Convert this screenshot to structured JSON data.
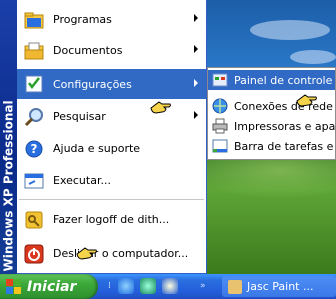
{
  "desktop": {
    "background": "bliss"
  },
  "start_menu": {
    "side_banner": "Windows XP Professional",
    "items": [
      {
        "label": "Programas",
        "icon": "programs-folder-icon",
        "submenu": true
      },
      {
        "label": "Documentos",
        "icon": "documents-folder-icon",
        "submenu": true
      },
      {
        "label": "Configurações",
        "icon": "settings-checklist-icon",
        "submenu": true,
        "active": true
      },
      {
        "label": "Pesquisar",
        "icon": "magnifier-icon",
        "submenu": true
      },
      {
        "label": "Ajuda e suporte",
        "icon": "help-icon",
        "submenu": false
      },
      {
        "label": "Executar...",
        "icon": "run-icon",
        "submenu": false
      },
      {
        "label": "Fazer logoff de dith...",
        "icon": "logoff-key-icon",
        "submenu": false
      },
      {
        "label": "Desligar o computador...",
        "icon": "power-icon",
        "submenu": false
      }
    ]
  },
  "settings_submenu": {
    "items": [
      {
        "label": "Painel de controle",
        "icon": "control-panel-icon",
        "active": true
      },
      {
        "label": "Conexões de rede",
        "icon": "network-connections-icon"
      },
      {
        "label": "Impressoras e aparelhos de fax",
        "icon": "printer-icon"
      },
      {
        "label": "Barra de tarefas e menu Iniciar",
        "icon": "taskbar-icon"
      }
    ]
  },
  "taskbar": {
    "start_label": "Iniciar",
    "quick_launch": [
      "ie-icon",
      "outlook-express-icon",
      "media-player-icon"
    ],
    "task_label": "Jasc Paint ..."
  },
  "colors": {
    "highlight": "#316ac5",
    "taskbar": "#245edb",
    "start_button": "#3ca83a",
    "banner": "#0a2a8a"
  }
}
